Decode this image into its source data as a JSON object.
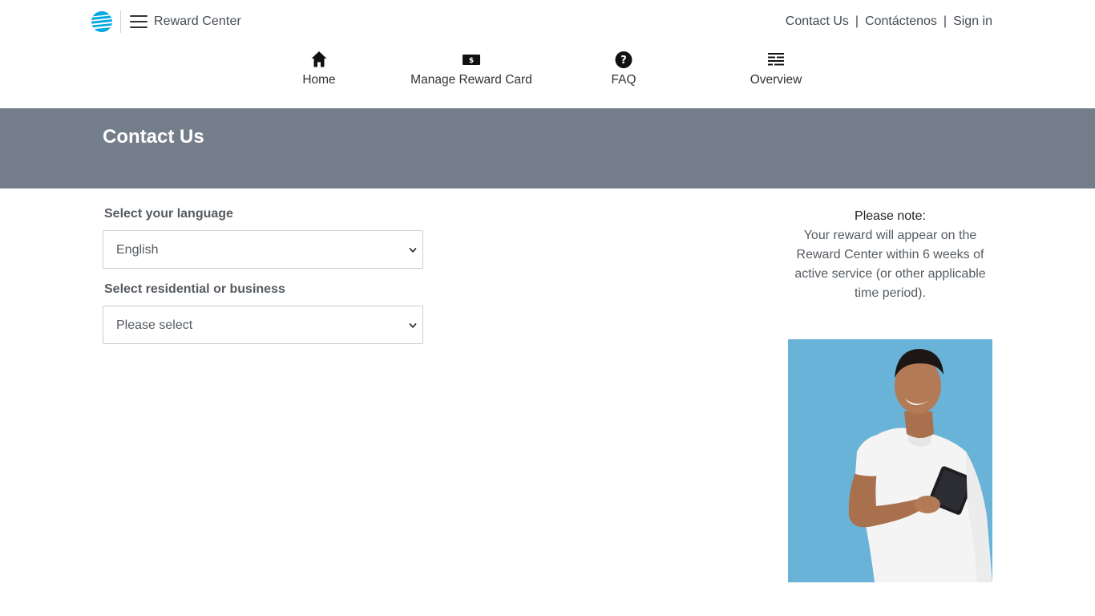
{
  "header": {
    "brand_label": "Reward Center",
    "logo_icon": "att-globe-icon",
    "menu_icon": "hamburger-menu-icon",
    "utility_links": [
      "Contact Us",
      "Contáctenos",
      "Sign in"
    ],
    "separator": "|"
  },
  "nav": {
    "items": [
      {
        "label": "Home",
        "icon": "home-icon"
      },
      {
        "label": "Manage Reward Card",
        "icon": "dollar-card-icon"
      },
      {
        "label": "FAQ",
        "icon": "question-circle-icon"
      },
      {
        "label": "Overview",
        "icon": "list-lines-icon"
      }
    ]
  },
  "banner": {
    "title": "Contact Us"
  },
  "form": {
    "language_label": "Select your language",
    "language_value": "English",
    "account_label": "Select residential or business",
    "account_value": "Please select"
  },
  "note": {
    "title": "Please note:",
    "body": "Your reward will appear on the Reward Center within 6 weeks of active service (or other applicable time period)."
  },
  "colors": {
    "banner": "#747e8a",
    "att_blue": "#00a8e0",
    "photo_bg": "#6ab3d8"
  }
}
